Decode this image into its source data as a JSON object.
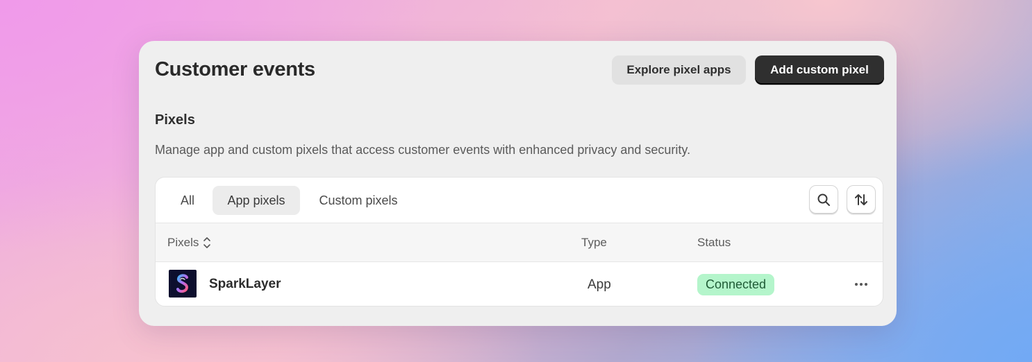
{
  "header": {
    "title": "Customer events",
    "explore_label": "Explore pixel apps",
    "add_label": "Add custom pixel"
  },
  "section": {
    "title": "Pixels",
    "description": "Manage app and custom pixels that access customer events with enhanced privacy and security."
  },
  "tabs": [
    {
      "label": "All",
      "selected": false
    },
    {
      "label": "App pixels",
      "selected": true
    },
    {
      "label": "Custom pixels",
      "selected": false
    }
  ],
  "toolbar_icons": [
    "search-icon",
    "sort-icon"
  ],
  "table": {
    "columns": [
      "Pixels",
      "Type",
      "Status"
    ],
    "rows": [
      {
        "name": "SparkLayer",
        "type": "App",
        "status": "Connected",
        "icon": "sparklayer-logo"
      }
    ]
  },
  "colors": {
    "primary_button": "#2f2f2f",
    "status_connected_bg": "#b4f5cb",
    "status_connected_text": "#1f5b36",
    "card_bg": "#efefef"
  }
}
